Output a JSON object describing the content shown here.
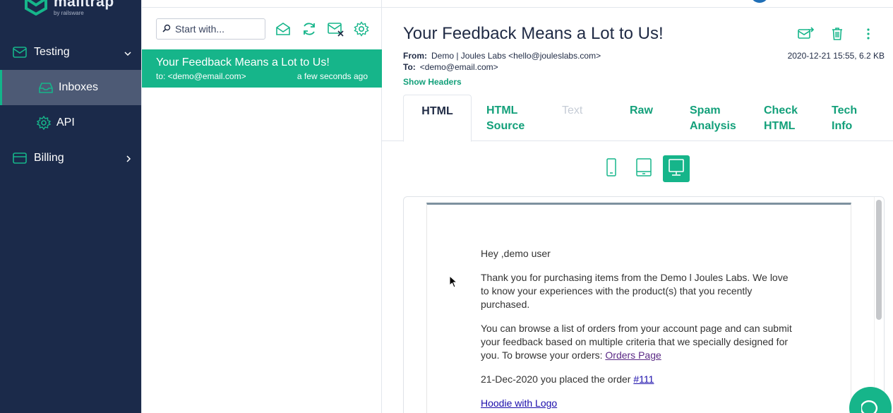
{
  "brand": {
    "name": "mailtrap",
    "sub": "by railsware",
    "accent": "#16b58a",
    "sidebar_bg": "#1b2a4a"
  },
  "sidebar": {
    "testing": {
      "label": "Testing",
      "icon": "mail-check-icon"
    },
    "inboxes": {
      "label": "Inboxes",
      "icon": "inbox-icon"
    },
    "api": {
      "label": "API",
      "icon": "gear-icon"
    },
    "billing": {
      "label": "Billing",
      "icon": "card-icon"
    }
  },
  "list": {
    "search_placeholder": "Start with...",
    "toolbar_icons": [
      "mark-read-icon",
      "refresh-icon",
      "clear-inbox-icon",
      "settings-icon"
    ],
    "messages": [
      {
        "subject": "Your Feedback Means a Lot to Us!",
        "to": "to: <demo@email.com>",
        "time": "a few seconds ago"
      }
    ]
  },
  "message": {
    "subject": "Your Feedback Means a Lot to Us!",
    "from_label": "From:",
    "from": "Demo | Joules Labs <hello@jouleslabs.com>",
    "to_label": "To:",
    "to": "<demo@email.com>",
    "date_size": "2020-12-21 15:55, 6.2 KB",
    "show_headers": "Show Headers",
    "actions": [
      "forward-icon",
      "trash-icon",
      "more-icon"
    ]
  },
  "tabs": [
    {
      "label": "HTML",
      "state": "active"
    },
    {
      "label": "HTML Source",
      "state": "normal"
    },
    {
      "label": "Text",
      "state": "disabled"
    },
    {
      "label": "Raw",
      "state": "normal"
    },
    {
      "label": "Spam Analysis",
      "state": "normal"
    },
    {
      "label": "Check HTML",
      "state": "normal"
    },
    {
      "label": "Tech Info",
      "state": "normal"
    }
  ],
  "device_toggle": {
    "options": [
      "mobile-icon",
      "tablet-icon",
      "desktop-icon"
    ],
    "selected": "desktop-icon"
  },
  "email": {
    "greeting": "Hey ,demo user",
    "para1": "Thank you for purchasing items from the Demo l Joules Labs. We love to know your experiences with the product(s) that you recently purchased.",
    "para2_text": "You can browse a list of orders from your account page and can submit your feedback based on multiple criteria that we specially designed for you. To browse your orders:",
    "para2_link": "Orders Page",
    "order_text": "21-Dec-2020 you placed the order",
    "order_link": "#111",
    "product_link": "Hoodie with Logo"
  }
}
